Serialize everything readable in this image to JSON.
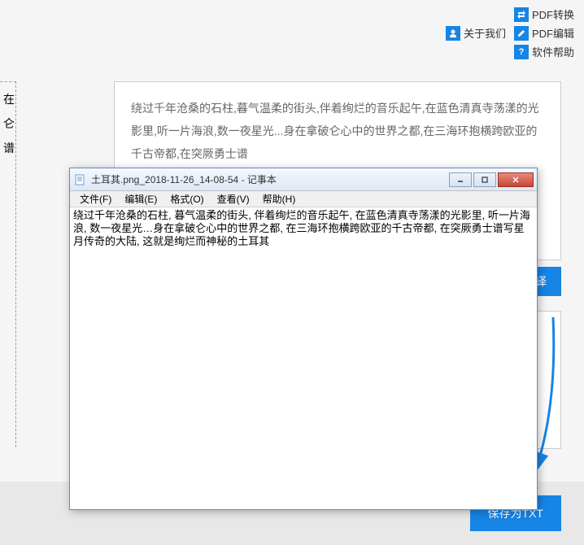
{
  "topbar": {
    "about": "关于我们",
    "pdf_convert": "PDF转换",
    "pdf_edit": "PDF编辑",
    "software_help": "软件帮助"
  },
  "left_text": {
    "l1": "在",
    "l2": "仑",
    "l3": "谱"
  },
  "textbox": {
    "content": "绕过千年沧桑的石柱,暮气温柔的街头,伴着绚烂的音乐起午,在蓝色清真寺荡漾的光影里,听一片海浪,数一夜星光...身在拿破仑心中的世界之都,在三海环抱横跨欧亚的千古帝都,在突厥勇士谱"
  },
  "translate_btn": "击翻译",
  "save_btn": "保存为TXT",
  "notepad": {
    "title": "土耳其.png_2018-11-26_14-08-54 - 记事本",
    "menu": {
      "file": "文件(F)",
      "edit": "编辑(E)",
      "format": "格式(O)",
      "view": "查看(V)",
      "help": "帮助(H)"
    },
    "content": "绕过千年沧桑的石柱, 暮气温柔的街头, 伴着绚烂的音乐起午, 在蓝色清真寺荡漾的光影里, 听一片海浪, 数一夜星光…身在拿破仑心中的世界之都, 在三海环抱横跨欧亚的千古帝都, 在突厥勇士谱写星月传奇的大陆, 这就是绚烂而神秘的土耳其"
  }
}
